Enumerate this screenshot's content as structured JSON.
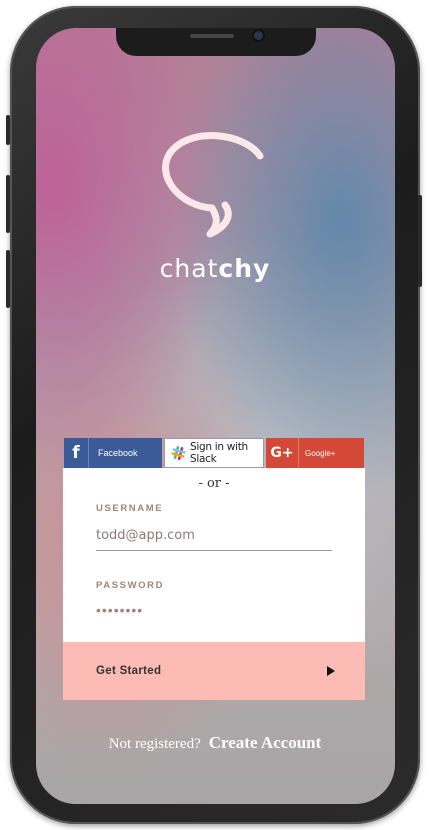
{
  "app": {
    "brand_part1": "chat",
    "brand_part2": "chy"
  },
  "social": {
    "facebook_label": "Facebook",
    "slack_label": "Sign in with Slack",
    "google_label": "Google+",
    "facebook_glyph": "f",
    "google_glyph": "G+"
  },
  "form": {
    "separator": "- or -",
    "username_label": "USERNAME",
    "username_value": "todd@app.com",
    "password_label": "PASSWORD",
    "password_value": "••••••••",
    "submit_label": "Get Started"
  },
  "footer": {
    "question": "Not registered?",
    "create_link": "Create Account"
  },
  "colors": {
    "facebook": "#3b5a98",
    "google": "#d34836",
    "cta": "#fcbbb4",
    "label": "#a08478"
  }
}
